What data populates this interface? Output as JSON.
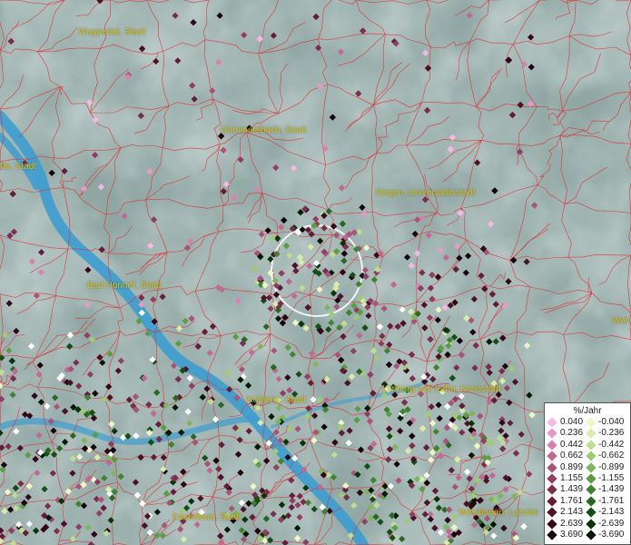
{
  "places": [
    {
      "id": "wuppertal",
      "label": "Wuppertal, Stadt"
    },
    {
      "id": "gummersbach",
      "label": "Gummersbach, Stadt"
    },
    {
      "id": "koeln",
      "label": "Köln, Stadt"
    },
    {
      "id": "siegen",
      "label": "Siegen, Universitätsstadt"
    },
    {
      "id": "bad-honnef",
      "label": "Bad Honnef, Stadt"
    },
    {
      "id": "koblenz",
      "label": "Koblenz, Stadt"
    },
    {
      "id": "limburg",
      "label": "Limburg a.d. Lahn, Kreisstadt"
    },
    {
      "id": "kastellaun",
      "label": "Kastellaun, Stadt"
    },
    {
      "id": "wiesbaden",
      "label": "Wiesbaden, Landes"
    },
    {
      "id": "wetzlar",
      "label": "Wet"
    }
  ],
  "legend": {
    "title": "%/Jahr",
    "positive": [
      {
        "value": "0.040",
        "color": "#f8b8e6"
      },
      {
        "value": "0.236",
        "color": "#e79ac6"
      },
      {
        "value": "0.442",
        "color": "#d782ae"
      },
      {
        "value": "0.662",
        "color": "#c06a93"
      },
      {
        "value": "0.899",
        "color": "#a85479"
      },
      {
        "value": "1.155",
        "color": "#8f3f61"
      },
      {
        "value": "1.439",
        "color": "#7a2d4c"
      },
      {
        "value": "1.761",
        "color": "#631d38"
      },
      {
        "value": "2.143",
        "color": "#4c1126"
      },
      {
        "value": "2.639",
        "color": "#330716"
      },
      {
        "value": "3.690",
        "color": "#160109"
      }
    ],
    "negative": [
      {
        "value": "-0.040",
        "color": "#eef7c6"
      },
      {
        "value": "-0.236",
        "color": "#d8edaa"
      },
      {
        "value": "-0.442",
        "color": "#bedd90"
      },
      {
        "value": "-0.662",
        "color": "#9fcb77"
      },
      {
        "value": "-0.899",
        "color": "#7eb55d"
      },
      {
        "value": "-1.155",
        "color": "#5c9c44"
      },
      {
        "value": "-1.439",
        "color": "#3f8231"
      },
      {
        "value": "-1.761",
        "color": "#286822"
      },
      {
        "value": "-2.143",
        "color": "#144d15"
      },
      {
        "value": "-2.639",
        "color": "#08330b"
      },
      {
        "value": "-3.690",
        "color": "#021a04"
      }
    ]
  },
  "colors": {
    "terrain": "#8fa6a3",
    "river": "#3d9ccf",
    "boundary": "#e0262a",
    "label": "#d4c21a",
    "highlight": "#ffffff"
  }
}
